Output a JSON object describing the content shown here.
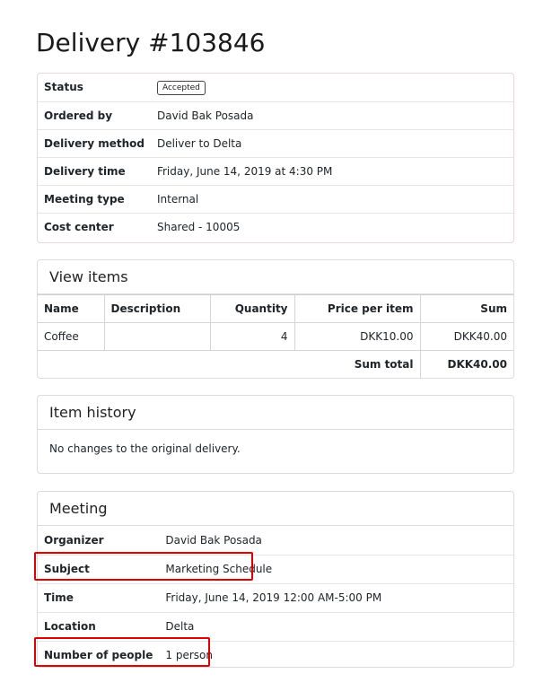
{
  "page": {
    "title": "Delivery #103846"
  },
  "delivery": {
    "status_label": "Status",
    "status_value": "Accepted",
    "ordered_by_label": "Ordered by",
    "ordered_by_value": "David Bak Posada",
    "method_label": "Delivery method",
    "method_value": "Deliver to Delta",
    "time_label": "Delivery time",
    "time_value": "Friday, June 14, 2019 at 4:30 PM",
    "meeting_type_label": "Meeting type",
    "meeting_type_value": "Internal",
    "cost_center_label": "Cost center",
    "cost_center_value": "Shared - 10005"
  },
  "items": {
    "header": "View items",
    "columns": [
      "Name",
      "Description",
      "Quantity",
      "Price per item",
      "Sum"
    ],
    "rows": [
      {
        "name": "Coffee",
        "description": "",
        "quantity": "4",
        "price": "DKK10.00",
        "sum": "DKK40.00"
      }
    ],
    "sum_total_label": "Sum total",
    "sum_total_value": "DKK40.00"
  },
  "history": {
    "header": "Item history",
    "text": "No changes to the original delivery."
  },
  "meeting": {
    "header": "Meeting",
    "organizer_label": "Organizer",
    "organizer_value": "David Bak Posada",
    "subject_label": "Subject",
    "subject_value": "Marketing Schedule",
    "time_label": "Time",
    "time_value": "Friday, June 14, 2019 12:00 AM-5:00 PM",
    "location_label": "Location",
    "location_value": "Delta",
    "people_label": "Number of people",
    "people_value": "1 person"
  },
  "colors": {
    "highlight": "#e00000"
  }
}
